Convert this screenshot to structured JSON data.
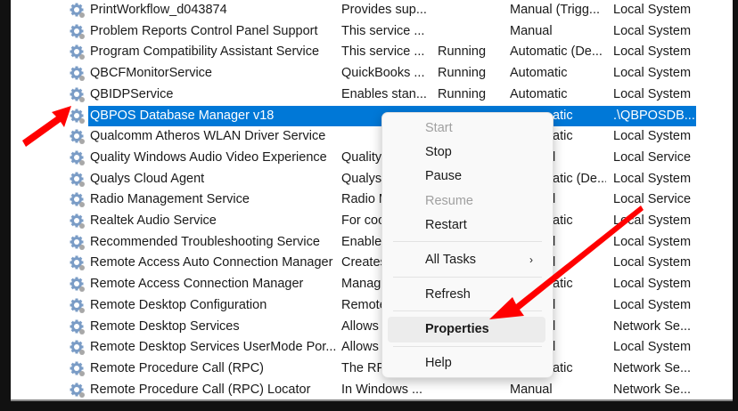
{
  "services": [
    {
      "name": "PrintWorkflow_d043874",
      "description": "Provides sup...",
      "status": "",
      "startup": "Manual (Trigg...",
      "logon": "Local System"
    },
    {
      "name": "Problem Reports Control Panel Support",
      "description": "This service ...",
      "status": "",
      "startup": "Manual",
      "logon": "Local System"
    },
    {
      "name": "Program Compatibility Assistant Service",
      "description": "This service ...",
      "status": "Running",
      "startup": "Automatic (De...",
      "logon": "Local System"
    },
    {
      "name": "QBCFMonitorService",
      "description": "QuickBooks ...",
      "status": "Running",
      "startup": "Automatic",
      "logon": "Local System"
    },
    {
      "name": "QBIDPService",
      "description": "Enables stan...",
      "status": "Running",
      "startup": "Automatic",
      "logon": "Local System"
    },
    {
      "name": "QBPOS Database Manager v18",
      "description": "",
      "status": "",
      "startup_partial": "atic",
      "logon": ".\\QBPOSDB...",
      "selected": true
    },
    {
      "name": "Qualcomm Atheros WLAN Driver Service",
      "description": "",
      "status": "",
      "startup_partial": "atic",
      "logon": "Local System"
    },
    {
      "name": "Quality Windows Audio Video Experience",
      "description": "Quality",
      "status": "",
      "startup_partial": "l",
      "logon": "Local Service"
    },
    {
      "name": "Qualys Cloud Agent",
      "description": "Qualys",
      "status": "",
      "startup_partial": "atic (De...",
      "logon": "Local System"
    },
    {
      "name": "Radio Management Service",
      "description": "Radio M",
      "status": "",
      "startup_partial": "l",
      "logon": "Local Service"
    },
    {
      "name": "Realtek Audio Service",
      "description": "For coo",
      "status": "",
      "startup_partial": "atic",
      "logon": "Local System"
    },
    {
      "name": "Recommended Troubleshooting Service",
      "description": "Enables",
      "status": "",
      "startup_partial": "l",
      "logon": "Local System"
    },
    {
      "name": "Remote Access Auto Connection Manager",
      "description": "Creates",
      "status": "",
      "startup_partial": "l",
      "logon": "Local System"
    },
    {
      "name": "Remote Access Connection Manager",
      "description": "Manag",
      "status": "",
      "startup_partial": "atic",
      "logon": "Local System"
    },
    {
      "name": "Remote Desktop Configuration",
      "description": "Remote",
      "status": "",
      "startup_partial": "l",
      "logon": "Local System"
    },
    {
      "name": "Remote Desktop Services",
      "description": "Allows",
      "status": "",
      "startup_partial": "l",
      "logon": "Network Se..."
    },
    {
      "name": "Remote Desktop Services UserMode Por...",
      "description": "Allows",
      "status": "",
      "startup_partial": "l",
      "logon": "Local System"
    },
    {
      "name": "Remote Procedure Call (RPC)",
      "description": "The RP",
      "status": "",
      "startup_partial": "atic",
      "logon": "Network Se..."
    },
    {
      "name": "Remote Procedure Call (RPC) Locator",
      "description": "In Windows ...",
      "status": "",
      "startup": "Manual",
      "logon": "Network Se..."
    }
  ],
  "context_menu": {
    "start": "Start",
    "stop": "Stop",
    "pause": "Pause",
    "resume": "Resume",
    "restart": "Restart",
    "all_tasks": "All Tasks",
    "submenu_arrow": "›",
    "refresh": "Refresh",
    "properties": "Properties",
    "help": "Help"
  },
  "colors": {
    "selection": "#0078d7",
    "annotation_arrow": "#ff0000"
  }
}
